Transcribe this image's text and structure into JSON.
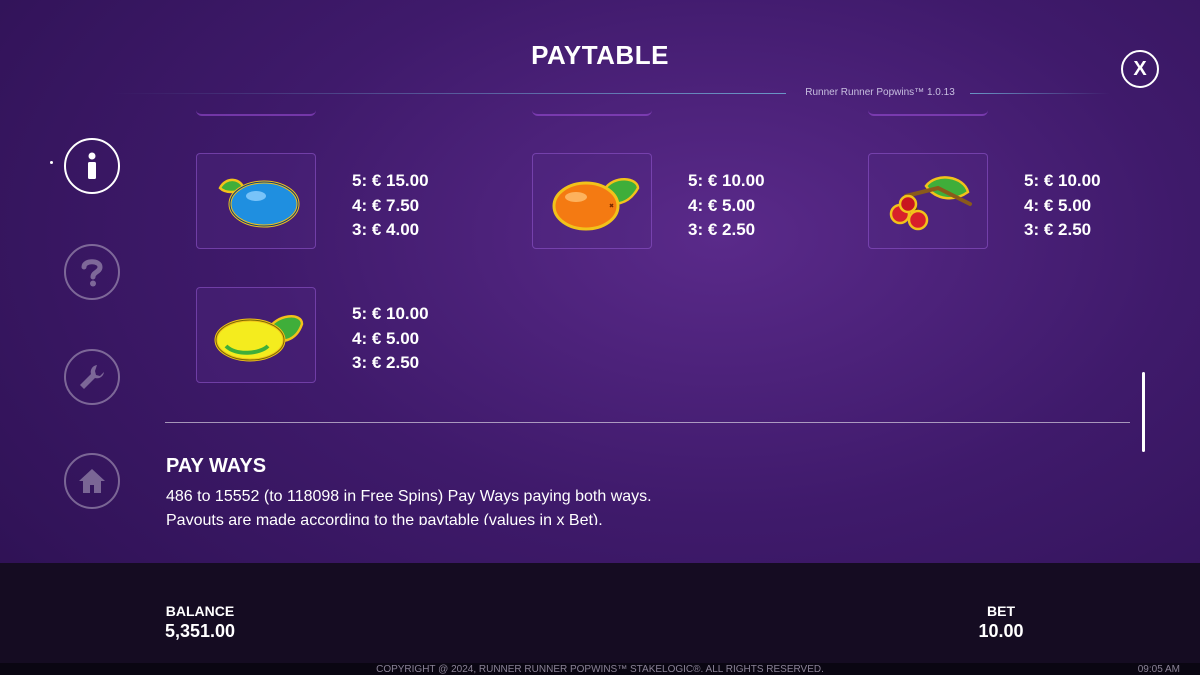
{
  "header": {
    "title": "PAYTABLE",
    "version": "Runner Runner Popwins™ 1.0.13",
    "close_label": "X"
  },
  "sidebar": {
    "items": [
      {
        "icon": "info-icon",
        "active": true
      },
      {
        "icon": "help-icon",
        "active": false
      },
      {
        "icon": "wrench-icon",
        "active": false
      },
      {
        "icon": "home-icon",
        "active": false
      }
    ]
  },
  "symbols": [
    {
      "icon": "blueberry-icon",
      "pay5": "5: € 15.00",
      "pay4": "4: € 7.50",
      "pay3": "3: € 4.00"
    },
    {
      "icon": "orange-icon",
      "pay5": "5: € 10.00",
      "pay4": "4: € 5.00",
      "pay3": "3: € 2.50"
    },
    {
      "icon": "cherries-icon",
      "pay5": "5: € 10.00",
      "pay4": "4: € 5.00",
      "pay3": "3: € 2.50"
    },
    {
      "icon": "lemon-icon",
      "pay5": "5: € 10.00",
      "pay4": "4: € 5.00",
      "pay3": "3: € 2.50"
    }
  ],
  "payways": {
    "title": "PAY WAYS",
    "line1": "486 to 15552 (to 118098 in Free Spins) Pay Ways paying both ways.",
    "line2": "Payouts are made according to the paytable (values in x Bet)."
  },
  "bottom": {
    "balance_label": "BALANCE",
    "balance_value": "5,351.00",
    "bet_label": "BET",
    "bet_value": "10.00"
  },
  "footer": {
    "copyright": "COPYRIGHT @ 2024, RUNNER RUNNER POPWINS™ STAKELOGIC®. ALL RIGHTS RESERVED.",
    "clock": "09:05 AM"
  },
  "colors": {
    "background": "#3f1a6b",
    "bottom_bar": "#150c22",
    "accent_line": "#78c8e6"
  }
}
